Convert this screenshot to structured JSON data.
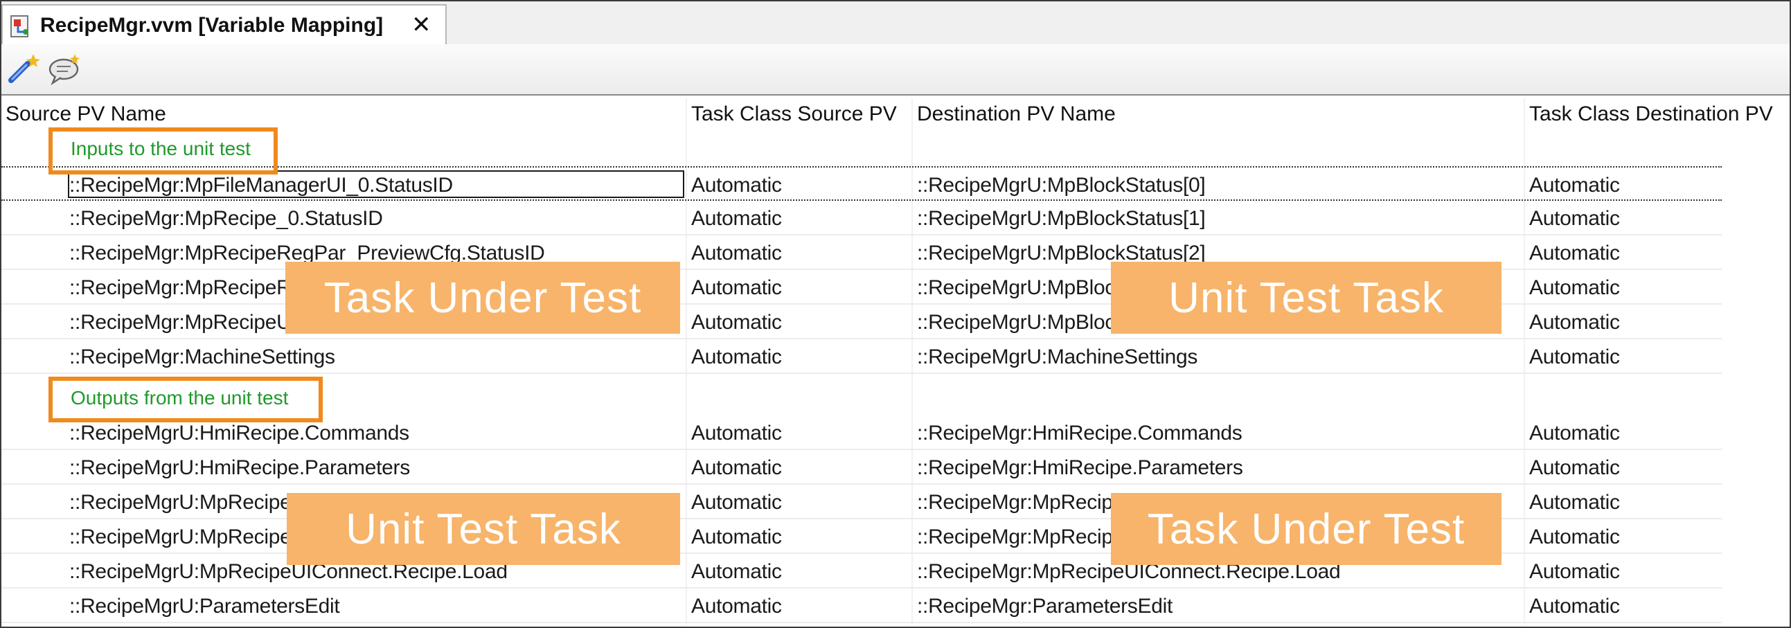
{
  "tab": {
    "title": "RecipeMgr.vvm [Variable Mapping]",
    "close_glyph": "✕"
  },
  "toolbar": {
    "buttons": [
      {
        "icon": "new-mapping-icon"
      },
      {
        "icon": "new-comment-icon"
      }
    ]
  },
  "columns": [
    "Source PV Name",
    "Task Class Source PV",
    "Destination PV Name",
    "Task Class Destination PV"
  ],
  "groups": [
    {
      "label": "Inputs to the unit test",
      "rows": [
        {
          "src": "::RecipeMgr:MpFileManagerUI_0.StatusID",
          "tc_src": "Automatic",
          "dst": "::RecipeMgrU:MpBlockStatus[0]",
          "tc_dst": "Automatic"
        },
        {
          "src": "::RecipeMgr:MpRecipe_0.StatusID",
          "tc_src": "Automatic",
          "dst": "::RecipeMgrU:MpBlockStatus[1]",
          "tc_dst": "Automatic"
        },
        {
          "src": "::RecipeMgr:MpRecipeRegPar_PreviewCfg.StatusID",
          "tc_src": "Automatic",
          "dst": "::RecipeMgrU:MpBlockStatus[2]",
          "tc_dst": "Automatic"
        },
        {
          "src": "::RecipeMgr:MpRecipeR",
          "tc_src": "Automatic",
          "dst": "::RecipeMgrU:MpBloc",
          "tc_dst": "Automatic"
        },
        {
          "src": "::RecipeMgr:MpRecipeU",
          "tc_src": "Automatic",
          "dst": "::RecipeMgrU:MpBloc",
          "tc_dst": "Automatic"
        },
        {
          "src": "::RecipeMgr:MachineSettings",
          "tc_src": "Automatic",
          "dst": "::RecipeMgrU:MachineSettings",
          "tc_dst": "Automatic"
        }
      ]
    },
    {
      "label": "Outputs from the unit test",
      "rows": [
        {
          "src": "::RecipeMgrU:HmiRecipe.Commands",
          "tc_src": "Automatic",
          "dst": "::RecipeMgr:HmiRecipe.Commands",
          "tc_dst": "Automatic"
        },
        {
          "src": "::RecipeMgrU:HmiRecipe.Parameters",
          "tc_src": "Automatic",
          "dst": "::RecipeMgr:HmiRecipe.Parameters",
          "tc_dst": "Automatic"
        },
        {
          "src": "::RecipeMgrU:MpRecipe",
          "tc_src": "Automatic",
          "dst": "::RecipeMgr:MpRecip",
          "tc_dst": "Automatic"
        },
        {
          "src": "::RecipeMgrU:MpRecipe",
          "tc_src": "Automatic",
          "dst": "::RecipeMgr:MpRecip",
          "tc_dst": "Automatic"
        },
        {
          "src": "::RecipeMgrU:MpRecipeUIConnect.Recipe.Load",
          "tc_src": "Automatic",
          "dst": "::RecipeMgr:MpRecipeUIConnect.Recipe.Load",
          "tc_dst": "Automatic"
        },
        {
          "src": "::RecipeMgrU:ParametersEdit",
          "tc_src": "Automatic",
          "dst": "::RecipeMgr:ParametersEdit",
          "tc_dst": "Automatic"
        }
      ]
    }
  ],
  "overlays": [
    "Task Under Test",
    "Unit Test Task",
    "Unit Test Task",
    "Task Under Test"
  ],
  "colors": {
    "overlay": "#f7b46a",
    "highlight": "#f08a1c",
    "group_label": "#1f9a2a"
  }
}
